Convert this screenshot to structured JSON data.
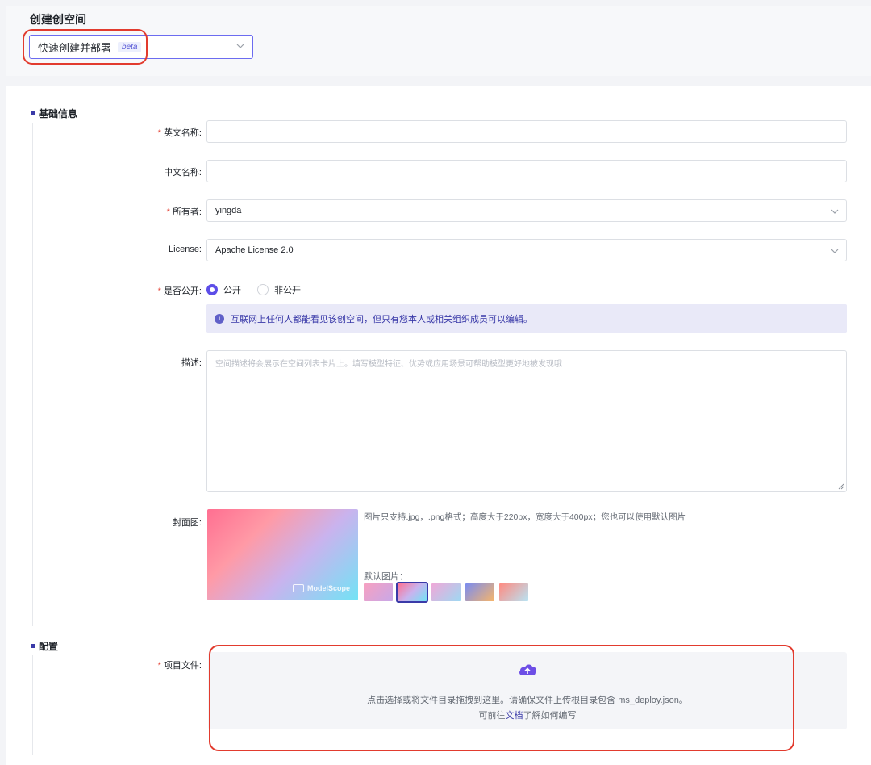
{
  "header": {
    "title": "创建创空间",
    "mode_select": {
      "value": "快速创建并部署",
      "badge": "beta"
    }
  },
  "basic_section": {
    "title": "基础信息",
    "fields": {
      "english_name": {
        "label": "英文名称:",
        "required": true,
        "value": ""
      },
      "chinese_name": {
        "label": "中文名称:",
        "required": false,
        "value": ""
      },
      "owner": {
        "label": "所有者:",
        "required": true,
        "value": "yingda"
      },
      "license": {
        "label": "License:",
        "required": false,
        "value": "Apache License 2.0"
      },
      "visibility": {
        "label": "是否公开:",
        "required": true,
        "options": [
          "公开",
          "非公开"
        ],
        "selected": "公开",
        "info": "互联网上任何人都能看见该创空间，但只有您本人或相关组织成员可以编辑。"
      },
      "description": {
        "label": "描述:",
        "placeholder": "空间描述将会展示在空间列表卡片上。填写模型特征、优势或应用场景可帮助模型更好地被发现哦"
      },
      "cover": {
        "label": "封面图:",
        "hint": "图片只支持.jpg，.png格式；高度大于220px，宽度大于400px；您也可以使用默认图片",
        "watermark": "ModelScope",
        "default_label": "默认图片：",
        "selected_thumb": 1
      }
    }
  },
  "config_section": {
    "title": "配置",
    "project_file": {
      "label": "项目文件:",
      "required": true,
      "upload_text": "点击选择或将文件目录拖拽到这里。请确保文件上传根目录包含 ms_deploy.json。",
      "doc_prefix": "可前往",
      "doc_link": "文档",
      "doc_suffix": "了解如何编写"
    }
  },
  "colors": {
    "accent": "#5d4ee8",
    "annotation_red": "#e23b2e",
    "required_star": "#e5483b"
  }
}
